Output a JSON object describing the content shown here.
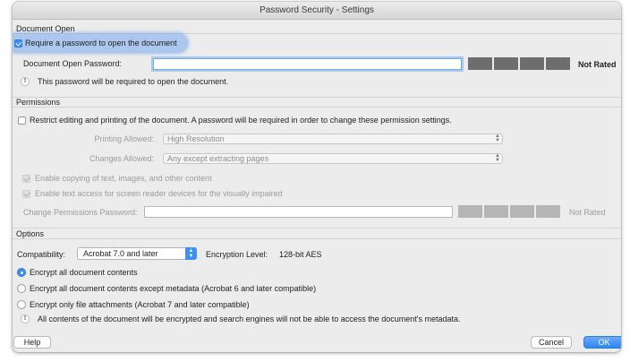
{
  "window": {
    "title": "Password Security - Settings"
  },
  "document_open": {
    "header": "Document Open",
    "require_label": "Require a password to open the document",
    "password_label": "Document Open Password:",
    "password_value": "",
    "rating": "Not Rated",
    "note": "This password will be required to open the document."
  },
  "permissions": {
    "header": "Permissions",
    "restrict_label": "Restrict editing and printing of the document. A password will be required in order to change these permission settings.",
    "printing_label": "Printing Allowed:",
    "printing_value": "High Resolution",
    "changes_label": "Changes Allowed:",
    "changes_value": "Any except extracting pages",
    "copy_label": "Enable copying of text, images, and other content",
    "access_label": "Enable text access for screen reader devices for the visually impaired",
    "change_pw_label": "Change Permissions Password:",
    "rating": "Not Rated"
  },
  "options": {
    "header": "Options",
    "compat_label": "Compatibility:",
    "compat_value": "Acrobat 7.0 and later",
    "encryption_label": "Encryption  Level:",
    "encryption_value": "128-bit AES",
    "radio_all": "Encrypt all document contents",
    "radio_except": "Encrypt all document contents except metadata (Acrobat 6 and later compatible)",
    "radio_attach": "Encrypt only file attachments (Acrobat 7 and later compatible)",
    "note": "All contents of the document will be encrypted and search engines will not be able to access the document's metadata."
  },
  "buttons": {
    "help": "Help",
    "cancel": "Cancel",
    "ok": "OK"
  },
  "colors": {
    "accent": "#3d8ef6",
    "meter": "#6d6d6d",
    "window_bg": "#ececec"
  },
  "icons": {
    "info": "info-icon",
    "check": "checkmark-icon",
    "arrows": "up-down-arrows-icon"
  }
}
